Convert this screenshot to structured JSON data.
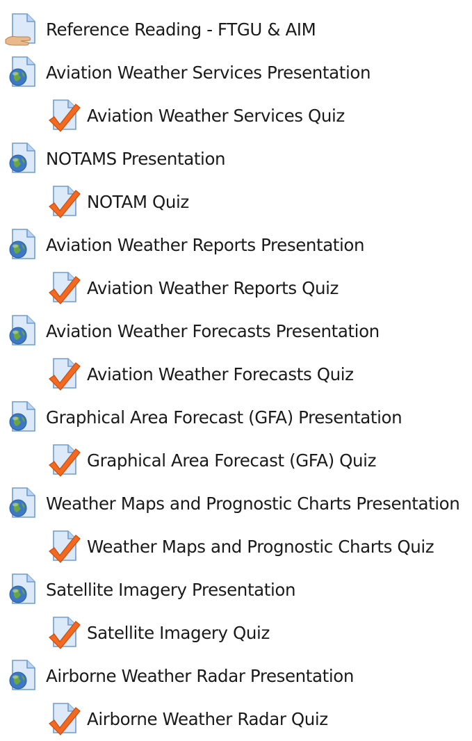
{
  "activities": [
    {
      "label": "Reference Reading - FTGU & AIM",
      "icon": "page-hand-icon"
    },
    {
      "label": "Aviation Weather Services Presentation",
      "icon": "url-globe-icon"
    },
    {
      "label": "Aviation Weather Services Quiz",
      "icon": "quiz-check-icon"
    },
    {
      "label": "NOTAMS Presentation",
      "icon": "url-globe-icon"
    },
    {
      "label": "NOTAM Quiz",
      "icon": "quiz-check-icon"
    },
    {
      "label": "Aviation Weather Reports Presentation",
      "icon": "url-globe-icon"
    },
    {
      "label": "Aviation Weather Reports Quiz",
      "icon": "quiz-check-icon"
    },
    {
      "label": "Aviation Weather Forecasts Presentation",
      "icon": "url-globe-icon"
    },
    {
      "label": "Aviation Weather Forecasts Quiz",
      "icon": "quiz-check-icon"
    },
    {
      "label": "Graphical Area Forecast (GFA) Presentation",
      "icon": "url-globe-icon"
    },
    {
      "label": "Graphical Area Forecast (GFA) Quiz",
      "icon": "quiz-check-icon"
    },
    {
      "label": "Weather Maps and Prognostic Charts Presentation",
      "icon": "url-globe-icon"
    },
    {
      "label": "Weather Maps and Prognostic Charts Quiz",
      "icon": "quiz-check-icon"
    },
    {
      "label": "Satellite Imagery Presentation",
      "icon": "url-globe-icon"
    },
    {
      "label": "Satellite Imagery Quiz",
      "icon": "quiz-check-icon"
    },
    {
      "label": "Airborne Weather Radar Presentation",
      "icon": "url-globe-icon"
    },
    {
      "label": "Airborne Weather Radar Quiz",
      "icon": "quiz-check-icon"
    }
  ],
  "colors": {
    "page_bg": "#dbe9f8",
    "page_border": "#6f9ccf",
    "globe_ocean": "#3d78c4",
    "globe_land": "#6aa544",
    "check": "#f26a21",
    "hand": "#e8b98a",
    "text": "#1a1a1a"
  }
}
